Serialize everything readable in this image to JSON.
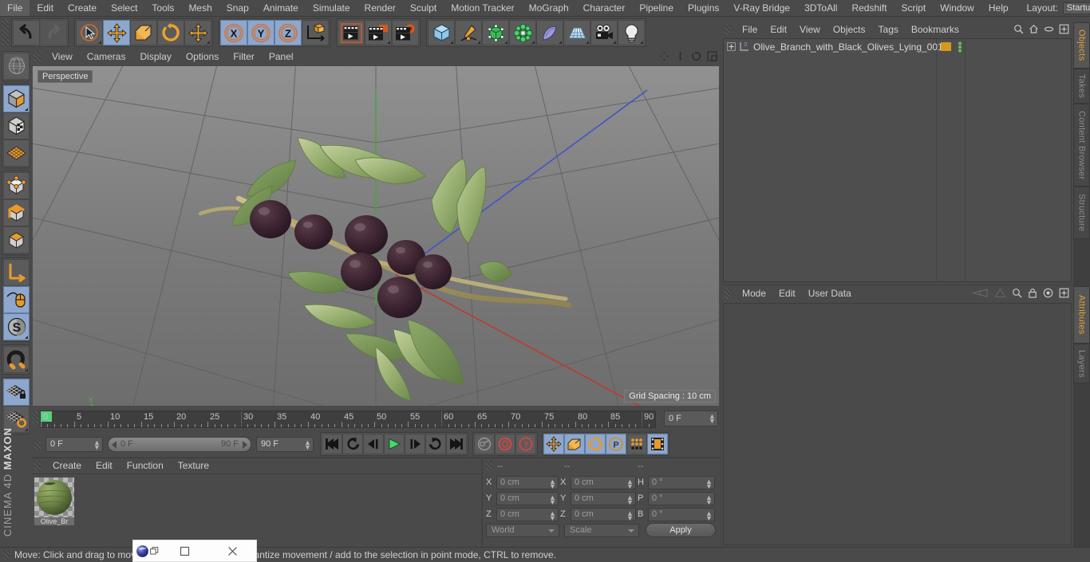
{
  "menubar": {
    "items": [
      "File",
      "Edit",
      "Create",
      "Select",
      "Tools",
      "Mesh",
      "Snap",
      "Animate",
      "Simulate",
      "Render",
      "Sculpt",
      "Motion Tracker",
      "MoGraph",
      "Character",
      "Pipeline",
      "Plugins",
      "V-Ray Bridge",
      "3DToAll",
      "Redshift",
      "Script",
      "Window",
      "Help"
    ],
    "layout_label": "Layout:",
    "layout_value": "Startup",
    "search_icon": "search-icon"
  },
  "toolbar": {
    "groups": [
      {
        "name": "history",
        "buttons": [
          {
            "icon": "undo-icon",
            "label": "Undo",
            "selected": false,
            "disabled": false
          },
          {
            "icon": "redo-icon",
            "label": "Redo",
            "selected": false,
            "disabled": true
          }
        ]
      },
      {
        "name": "tools",
        "buttons": [
          {
            "icon": "live-selection-icon",
            "label": "Live Selection",
            "selected": false,
            "corner": true
          },
          {
            "icon": "move-icon",
            "label": "Move",
            "selected": true
          },
          {
            "icon": "scale-icon",
            "label": "Scale",
            "selected": false
          },
          {
            "icon": "rotate-icon",
            "label": "Rotate",
            "selected": false
          },
          {
            "icon": "move-alt-icon",
            "label": "Move Tool",
            "selected": false,
            "corner": true
          }
        ]
      },
      {
        "name": "axis-locks",
        "buttons": [
          {
            "icon": "axis-x-icon",
            "label": "X",
            "selected": true
          },
          {
            "icon": "axis-y-icon",
            "label": "Y",
            "selected": true
          },
          {
            "icon": "axis-z-icon",
            "label": "Z",
            "selected": true
          },
          {
            "icon": "world-coordinates-icon",
            "label": "World / Object",
            "selected": false
          }
        ]
      },
      {
        "name": "render",
        "buttons": [
          {
            "icon": "render-view-icon",
            "label": "Render View",
            "selected": false
          },
          {
            "icon": "render-picture-viewer-icon",
            "label": "Render to Picture Viewer",
            "selected": false,
            "corner": true
          },
          {
            "icon": "render-settings-icon",
            "label": "Edit Render Settings",
            "selected": false
          }
        ]
      },
      {
        "name": "objects",
        "buttons": [
          {
            "icon": "cube-primitive-icon",
            "label": "Add Cube Object",
            "selected": false,
            "corner": true
          },
          {
            "icon": "spline-pen-icon",
            "label": "Add Spline Object",
            "selected": false,
            "corner": true
          },
          {
            "icon": "generator-icon",
            "label": "Add Generator Object",
            "selected": false,
            "corner": true
          },
          {
            "icon": "deformer-icon",
            "label": "Add Bend Object",
            "selected": false,
            "corner": true
          },
          {
            "icon": "environment-icon",
            "label": "Add Scene Object",
            "selected": false,
            "corner": true
          },
          {
            "icon": "floor-icon",
            "label": "Add Floor Object",
            "selected": false,
            "corner": true
          },
          {
            "icon": "camera-icon",
            "label": "Add Camera Object",
            "selected": false,
            "corner": true
          },
          {
            "icon": "light-icon",
            "label": "Add Light Object",
            "selected": false,
            "corner": true
          }
        ]
      }
    ]
  },
  "leftbar": {
    "groups": [
      {
        "buttons": [
          {
            "icon": "undo-view-icon",
            "label": "Undo View",
            "selected": false
          }
        ]
      },
      {
        "buttons": [
          {
            "icon": "model-mode-icon",
            "label": "Model Mode",
            "selected": true,
            "corner": true
          },
          {
            "icon": "texture-mode-icon",
            "label": "Texture Mode",
            "selected": false
          },
          {
            "icon": "workplane-mode-icon",
            "label": "Workplane Mode",
            "selected": false
          }
        ]
      },
      {
        "buttons": [
          {
            "icon": "points-mode-icon",
            "label": "Points Mode",
            "selected": false
          },
          {
            "icon": "edges-mode-icon",
            "label": "Edges Mode",
            "selected": false
          },
          {
            "icon": "polygons-mode-icon",
            "label": "Polygons Mode",
            "selected": false
          }
        ]
      },
      {
        "buttons": [
          {
            "icon": "axis-mode-icon",
            "label": "Enable Axis Modification",
            "selected": false
          },
          {
            "icon": "viewport-solo-icon",
            "label": "Viewport Solo Single",
            "selected": true
          },
          {
            "icon": "soft-selection-icon",
            "label": "Enable Soft Selection",
            "selected": true,
            "corner": true
          }
        ]
      },
      {
        "buttons": [
          {
            "icon": "snap-magnet-icon",
            "label": "Enable Snapping",
            "selected": false,
            "corner": true
          }
        ]
      },
      {
        "buttons": [
          {
            "icon": "workplane-lock-icon",
            "label": "Lock Workplane",
            "selected": true
          },
          {
            "icon": "workplane-rotate-icon",
            "label": "Planar Workplane Mode",
            "selected": false,
            "corner": true
          }
        ]
      }
    ],
    "brand_bold": "MAXON",
    "brand_light": "CINEMA 4D"
  },
  "viewport": {
    "menu_items": [
      "View",
      "Cameras",
      "Display",
      "Options",
      "Filter",
      "Panel"
    ],
    "corner_icons": [
      "pan-icon",
      "dolly-icon",
      "rotate-view-icon",
      "maximize-view-icon"
    ],
    "perspective_label": "Perspective",
    "grid_spacing_label": "Grid Spacing : 10 cm",
    "axis_labels": [
      "X",
      "Y",
      "Z"
    ],
    "axis_colors": {
      "x": "#d4463c",
      "y": "#5fbf49",
      "z": "#3f5fd0"
    },
    "scene_object": "olive branch with black olives"
  },
  "timeline": {
    "ticks": [
      0,
      5,
      10,
      15,
      20,
      25,
      30,
      35,
      40,
      45,
      50,
      55,
      60,
      65,
      70,
      75,
      80,
      85,
      90
    ],
    "frame_field": "0 F",
    "current_frame": 0,
    "range_start": "0 F",
    "range_end": "90 F",
    "end_frame_field": "90 F",
    "start_frame_field": "0 F"
  },
  "animbar": {
    "transport": [
      {
        "icon": "goto-start-icon",
        "label": "Go to Start",
        "selected": false
      },
      {
        "icon": "prev-key-icon",
        "label": "Go to Previous Key",
        "selected": false
      },
      {
        "icon": "step-back-icon",
        "label": "Go to Previous Frame",
        "selected": false
      },
      {
        "icon": "play-icon",
        "label": "Play Forwards",
        "selected": false
      },
      {
        "icon": "step-forward-icon",
        "label": "Go to Next Frame",
        "selected": false
      },
      {
        "icon": "next-key-icon",
        "label": "Go to Next Key",
        "selected": false
      },
      {
        "icon": "goto-end-icon",
        "label": "Go to End",
        "selected": false
      }
    ],
    "keys": [
      {
        "icon": "record-key-icon",
        "label": "Record Active Objects",
        "selected": false,
        "disabled": true
      },
      {
        "icon": "autokey-icon",
        "label": "Autokeying",
        "selected": false
      },
      {
        "icon": "keyframe-selection-icon",
        "label": "Keyframe Selection",
        "selected": false
      }
    ],
    "toggles": [
      {
        "icon": "key-position-icon",
        "label": "Position",
        "selected": true
      },
      {
        "icon": "key-scale-icon",
        "label": "Scale",
        "selected": true
      },
      {
        "icon": "key-rotation-icon",
        "label": "Rotation",
        "selected": true
      },
      {
        "icon": "key-pla-icon",
        "label": "Point Level Animation",
        "selected": true
      },
      {
        "icon": "key-parameter-icon",
        "label": "Parameter",
        "selected": false
      },
      {
        "icon": "timeline-strip-icon",
        "label": "Animation Mode",
        "selected": true
      }
    ]
  },
  "material_manager": {
    "menu_items": [
      "Create",
      "Edit",
      "Function",
      "Texture"
    ],
    "materials": [
      {
        "name": "Olive_Br",
        "color": "#6f8b4a"
      }
    ]
  },
  "coordinates": {
    "headers": [
      "--",
      "--",
      "--"
    ],
    "rows": [
      {
        "pos_label": "X",
        "pos_value": "0 cm",
        "size_label": "X",
        "size_value": "0 cm",
        "rot_label": "H",
        "rot_value": "0 °"
      },
      {
        "pos_label": "Y",
        "pos_value": "0 cm",
        "size_label": "Y",
        "size_value": "0 cm",
        "rot_label": "P",
        "rot_value": "0 °"
      },
      {
        "pos_label": "Z",
        "pos_value": "0 cm",
        "size_label": "Z",
        "size_value": "0 cm",
        "rot_label": "B",
        "rot_value": "0 °"
      }
    ],
    "system_value": "World",
    "mode_value": "Scale",
    "apply_label": "Apply"
  },
  "object_manager": {
    "menu_items": [
      "File",
      "Edit",
      "View",
      "Objects",
      "Tags",
      "Bookmarks"
    ],
    "header_icons": [
      "search-icon",
      "home-icon",
      "ellipse-icon",
      "plus-box-icon"
    ],
    "objects": [
      {
        "name": "Olive_Branch_with_Black_Olives_Lying_001",
        "tag_color": "#d39a1e",
        "expandable": true,
        "layer": "0"
      }
    ]
  },
  "attribute_manager": {
    "menu_items": [
      "Mode",
      "Edit",
      "User Data"
    ],
    "header_icons": [
      "history-back-icon",
      "history-forward-icon",
      "search-icon",
      "lock-icon",
      "target-icon",
      "plus-box-icon"
    ]
  },
  "right_tabs": {
    "upper": [
      {
        "label": "Objects",
        "active": true
      },
      {
        "label": "Takes",
        "active": false
      },
      {
        "label": "Content Browser",
        "active": false
      },
      {
        "label": "Structure",
        "active": false
      }
    ],
    "lower": [
      {
        "label": "Attributes",
        "active": true
      },
      {
        "label": "Layers",
        "active": false
      }
    ]
  },
  "statusbar": {
    "text": "Move: Click and drag to move the selection, SHIFT to quantize movement / add to the selection in point mode, CTRL to remove."
  },
  "mini_window": {
    "app_icon": "cinema4d-icon",
    "restore_label": "restore-icon",
    "maximize_label": "maximize-icon",
    "close_label": "close-icon"
  }
}
